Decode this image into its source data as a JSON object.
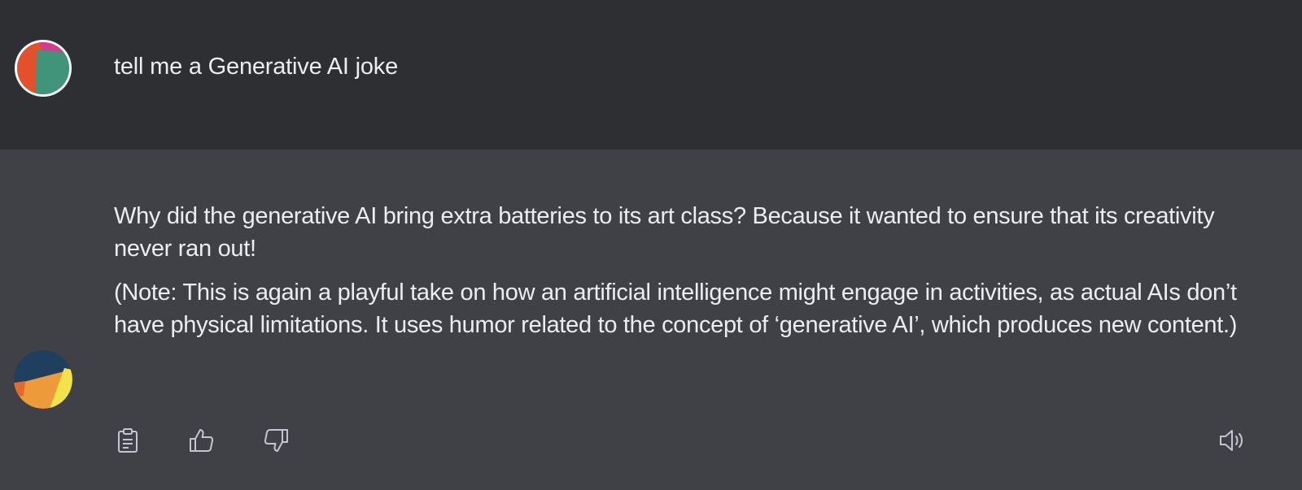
{
  "conversation": {
    "user_message": {
      "text": "tell me a Generative AI joke",
      "avatar": "user-avatar"
    },
    "assistant_message": {
      "avatar": "assistant-avatar",
      "paragraphs": [
        "Why did the generative AI bring extra batteries to its art class? Because it wanted to ensure that its creativity never ran out!",
        "(Note: This is again a playful take on how an artificial intelligence might engage in activities, as actual AIs don’t have physical limitations. It uses humor related to the concept of ‘generative AI’, which produces new content.)"
      ]
    }
  },
  "actions": {
    "copy": "clipboard-icon",
    "like": "thumbs-up-icon",
    "dislike": "thumbs-down-icon",
    "read_aloud": "speaker-icon"
  },
  "colors": {
    "user_row_bg": "#2e2f33",
    "assistant_row_bg": "#3f4146",
    "text": "#ececf1",
    "icon": "#c5c5d2"
  }
}
